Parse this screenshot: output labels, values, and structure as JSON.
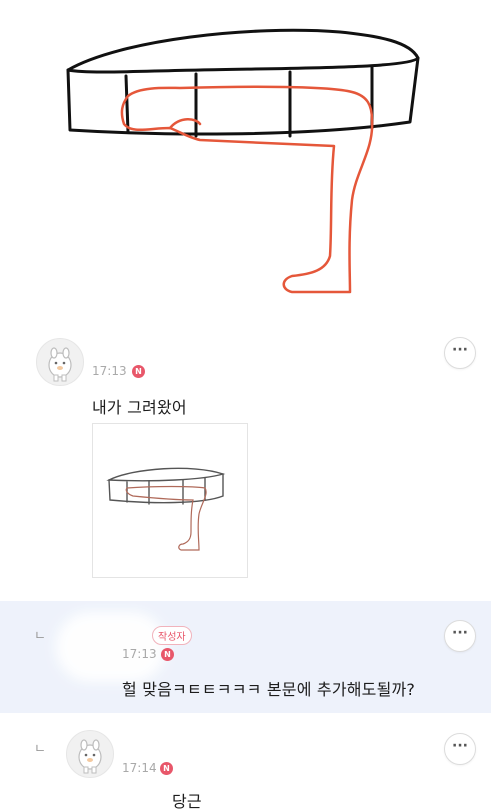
{
  "comments": [
    {
      "time": "17:13",
      "new_badge": "N",
      "text": "내가 그려왔어",
      "more_label": "···"
    },
    {
      "reply_mark": "ㄴ",
      "author_tag": "작성자",
      "time": "17:13",
      "new_badge": "N",
      "text": "헐 맞음ㅋㅌㅌㅋㅋㅋ 본문에 추가해도될까?",
      "more_label": "···"
    },
    {
      "reply_mark": "ㄴ",
      "time": "17:14",
      "new_badge": "N",
      "text": "당근",
      "more_label": "···"
    }
  ],
  "colors": {
    "badge": "#e8576a",
    "reply_highlight_bg": "#eef2fb",
    "sketch_black": "#111111",
    "sketch_red": "#e5573a"
  }
}
